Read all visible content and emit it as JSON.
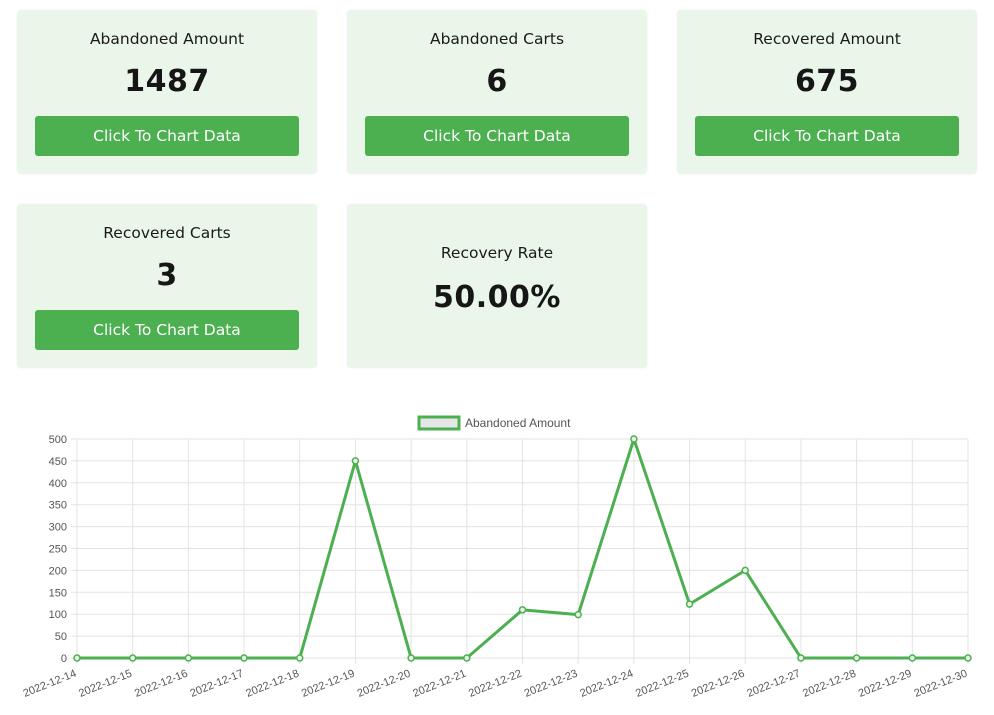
{
  "cards": [
    {
      "title": "Abandoned Amount",
      "value": "1487",
      "button": "Click To Chart Data"
    },
    {
      "title": "Abandoned Carts",
      "value": "6",
      "button": "Click To Chart Data"
    },
    {
      "title": "Recovered Amount",
      "value": "675",
      "button": "Click To Chart Data"
    },
    {
      "title": "Recovered Carts",
      "value": "3",
      "button": "Click To Chart Data"
    },
    {
      "title": "Recovery Rate",
      "value": "50.00%"
    }
  ],
  "colors": {
    "accent": "#4caf50",
    "card_bg": "#ebf6ea",
    "line": "#4caf50"
  },
  "chart_data": {
    "type": "line",
    "x": [
      "2022-12-14",
      "2022-12-15",
      "2022-12-16",
      "2022-12-17",
      "2022-12-18",
      "2022-12-19",
      "2022-12-20",
      "2022-12-21",
      "2022-12-22",
      "2022-12-23",
      "2022-12-24",
      "2022-12-25",
      "2022-12-26",
      "2022-12-27",
      "2022-12-28",
      "2022-12-29",
      "2022-12-30"
    ],
    "series": [
      {
        "name": "Abandoned Amount",
        "values": [
          0,
          0,
          0,
          0,
          0,
          450,
          0,
          0,
          110,
          99,
          500,
          123,
          200,
          0,
          0,
          0,
          0
        ]
      }
    ],
    "y_ticks": [
      "0",
      "50",
      "100",
      "150",
      "200",
      "250",
      "300",
      "350",
      "400",
      "450",
      "500"
    ],
    "ylim": [
      0,
      500
    ],
    "grid": true,
    "legend_position": "top"
  }
}
